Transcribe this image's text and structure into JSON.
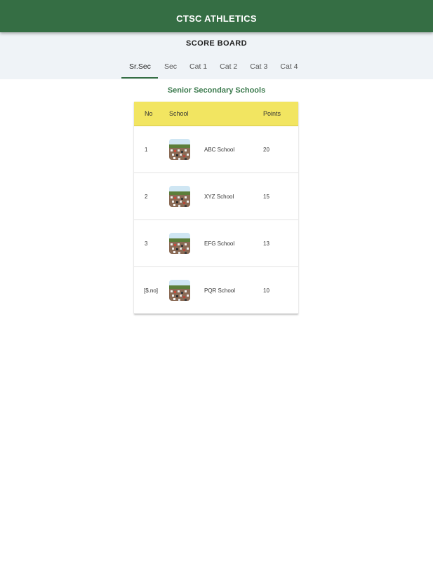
{
  "appbar": {
    "title": "CTSC ATHLETICS"
  },
  "header": {
    "title": "SCORE BOARD"
  },
  "tabs": [
    {
      "label": "Sr.Sec",
      "active": true
    },
    {
      "label": "Sec",
      "active": false
    },
    {
      "label": "Cat 1",
      "active": false
    },
    {
      "label": "Cat 2",
      "active": false
    },
    {
      "label": "Cat 3",
      "active": false
    },
    {
      "label": "Cat 4",
      "active": false
    }
  ],
  "section": {
    "title": "Senior Secondary Schools"
  },
  "table": {
    "columns": {
      "no": "No",
      "school": "School",
      "points": "Points"
    },
    "rows": [
      {
        "no": "1",
        "school": "ABC School",
        "points": "20",
        "image": "school-photo"
      },
      {
        "no": "2",
        "school": "XYZ School",
        "points": "15",
        "image": "school-photo"
      },
      {
        "no": "3",
        "school": "EFG School",
        "points": "13",
        "image": "school-photo"
      },
      {
        "no": "[$.no]",
        "school": "PQR School",
        "points": "10",
        "image": "school-photo"
      }
    ]
  },
  "colors": {
    "appbar": "#356e44",
    "accent": "#356e44",
    "table_header": "#f2e561",
    "subheader_bg": "#eff3f7"
  }
}
